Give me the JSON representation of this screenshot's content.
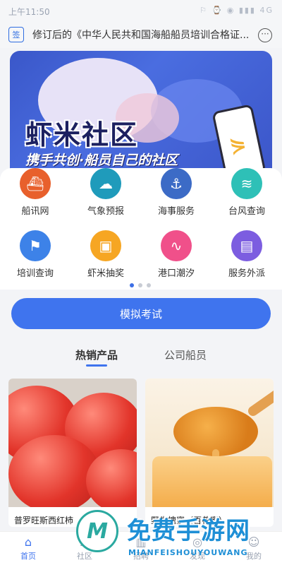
{
  "status_bar": {
    "time": "上午11:50",
    "icons": "⚐ ⌚ ◉ ▮▮▮ 4G"
  },
  "notice": {
    "badge": "签",
    "text": "修订后的《中华人民共和国海船船员培训合格证...",
    "more_icon": "more-icon"
  },
  "banner": {
    "title": "虾米社区",
    "subtitle": "携手共创·船员自己的社区"
  },
  "quick_row1": [
    {
      "label": "船讯网",
      "icon": "ship-icon",
      "color": "#e8602c"
    },
    {
      "label": "气象预报",
      "icon": "weather-icon",
      "color": "#1f9bbb"
    },
    {
      "label": "海事服务",
      "icon": "maritime-icon",
      "color": "#3c6bc6"
    },
    {
      "label": "台风查询",
      "icon": "typhoon-icon",
      "color": "#2ec0b7"
    }
  ],
  "quick_row2": [
    {
      "label": "培训查询",
      "icon": "training-icon",
      "color": "#3d82e8"
    },
    {
      "label": "虾米抽奖",
      "icon": "lottery-icon",
      "color": "#f6a623"
    },
    {
      "label": "港口潮汐",
      "icon": "tide-icon",
      "color": "#f0508a"
    },
    {
      "label": "服务外派",
      "icon": "service-icon",
      "color": "#7c5de0"
    }
  ],
  "exam_button": "模拟考试",
  "tabs": [
    {
      "label": "热销产品",
      "active": true
    },
    {
      "label": "公司船员",
      "active": false
    }
  ],
  "products": [
    {
      "name": "普罗旺斯西红柿"
    },
    {
      "name": "野生槐蜜（百花蜜）"
    }
  ],
  "tabbar": [
    {
      "label": "首页",
      "icon": "home-icon"
    },
    {
      "label": "社区",
      "icon": "community-icon"
    },
    {
      "label": "招聘",
      "icon": "jobs-icon"
    },
    {
      "label": "发现",
      "icon": "discover-icon"
    },
    {
      "label": "我的",
      "icon": "profile-icon"
    }
  ],
  "watermark": {
    "mark": "M",
    "title": "免费手游网",
    "sub": "MIANFEISHOUYOUWANG"
  }
}
